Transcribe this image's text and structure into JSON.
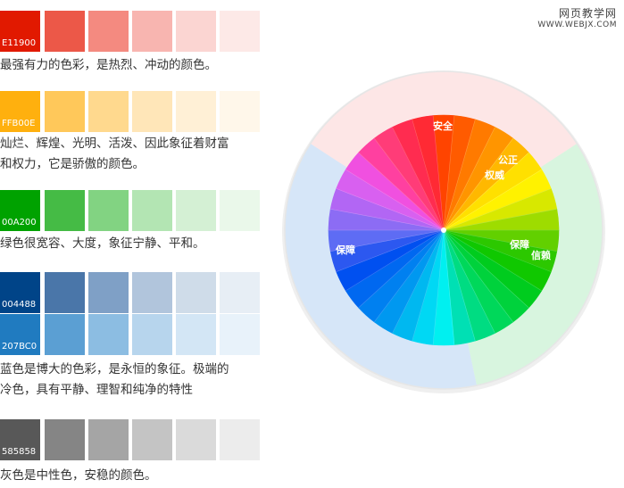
{
  "watermark": {
    "title_cn": "网页教学网",
    "url": "WWW.WEBJX.COM"
  },
  "palettes": [
    {
      "code": "E11900",
      "swatches": [
        "#e11900",
        "#ec5848",
        "#f48a80",
        "#f8b5b0",
        "#fbd5d2",
        "#fde9e7"
      ],
      "caption": [
        "最强有力的色彩，是热烈、冲动的颜色。"
      ]
    },
    {
      "code": "FFB00E",
      "swatches": [
        "#ffb00e",
        "#ffc85a",
        "#ffd98e",
        "#ffe6b8",
        "#fff0d6",
        "#fff7ea"
      ],
      "caption": [
        "灿烂、辉煌、光明、活泼、因此象征着财富",
        "和权力，它是骄傲的颜色。"
      ]
    },
    {
      "code": "00A200",
      "swatches": [
        "#00a200",
        "#45bb45",
        "#82d382",
        "#b3e5b3",
        "#d4f0d4",
        "#eaf8ea"
      ],
      "caption": [
        "绿色很宽容、大度，象征宁静、平和。"
      ]
    },
    {
      "code": "004488",
      "swatches": [
        "#004488",
        "#4a76a9",
        "#7fa0c6",
        "#b1c5dc",
        "#cfdce9",
        "#e7eef5"
      ],
      "caption": []
    },
    {
      "code": "207BC0",
      "swatches": [
        "#207bc0",
        "#5b9fd3",
        "#8cbde2",
        "#b7d5ed",
        "#d3e6f5",
        "#e8f2fa"
      ],
      "caption": [
        "蓝色是博大的色彩，是永恒的象征。极端的",
        "冷色，具有平静、理智和纯净的特性"
      ]
    },
    {
      "code": "585858",
      "swatches": [
        "#585858",
        "#858585",
        "#a5a5a5",
        "#c4c4c4",
        "#dadada",
        "#ececec"
      ],
      "caption": [
        "灰色是中性色，安稳的颜色。"
      ]
    }
  ],
  "wheel": {
    "ring": {
      "red": "#fde6e6",
      "green": "#d8f5df",
      "blue": "#d6e6f8",
      "border": "#e6e6e6"
    },
    "segments": [
      "#ff4400",
      "#ff5b00",
      "#ff7a00",
      "#ff9500",
      "#ffb800",
      "#ffe000",
      "#fff200",
      "#d8e800",
      "#9edc00",
      "#62d000",
      "#2cc800",
      "#10c800",
      "#00cc1e",
      "#00d23c",
      "#00d85a",
      "#00dc82",
      "#00e0b4",
      "#00f0f0",
      "#00d8f4",
      "#00b8f0",
      "#0098f0",
      "#0080f0",
      "#0068f0",
      "#0050f0",
      "#2c58f0",
      "#5e6cf4",
      "#8c6cf4",
      "#b266f4",
      "#d860f0",
      "#f050e0",
      "#ff40a0",
      "#ff3c78",
      "#ff2c50",
      "#ff2a34"
    ],
    "labels": {
      "safe": "安全",
      "justice": "公正",
      "authority": "权威",
      "protect_right": "保障",
      "trust": "信赖",
      "protect_left": "保障"
    }
  }
}
